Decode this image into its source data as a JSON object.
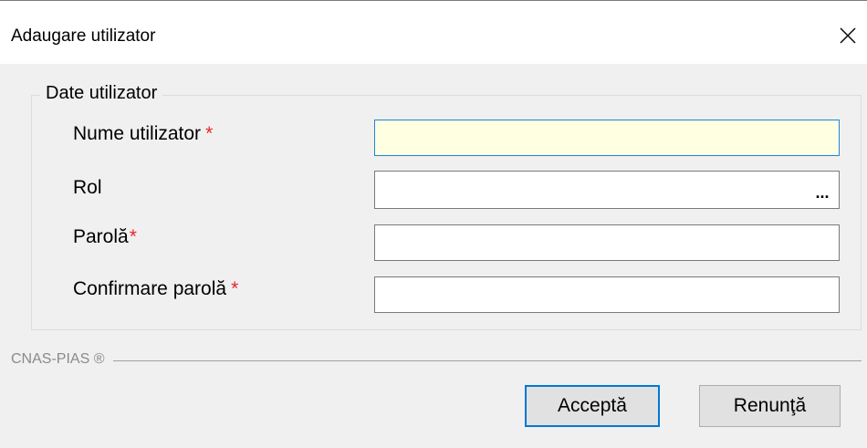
{
  "window": {
    "title": "Adaugare utilizator",
    "close_icon": "close-icon"
  },
  "group": {
    "legend": "Date utilizator"
  },
  "fields": {
    "username": {
      "label": "Nume utilizator",
      "required_mark": "*",
      "value": ""
    },
    "role": {
      "label": "Rol",
      "value": "",
      "browse_label": "..."
    },
    "password": {
      "label": "Parolă",
      "required_mark": "*",
      "value": ""
    },
    "confirm_password": {
      "label": "Confirmare parolă",
      "required_mark": "*",
      "value": ""
    }
  },
  "footer": {
    "brand": "CNAS-PIAS ®"
  },
  "buttons": {
    "accept": "Acceptă",
    "cancel": "Renunţă"
  },
  "colors": {
    "required": "#e8252a",
    "focused_field_bg": "#ffffe1",
    "focus_border": "#1e86d8",
    "dialog_bg": "#f0f0f0"
  }
}
